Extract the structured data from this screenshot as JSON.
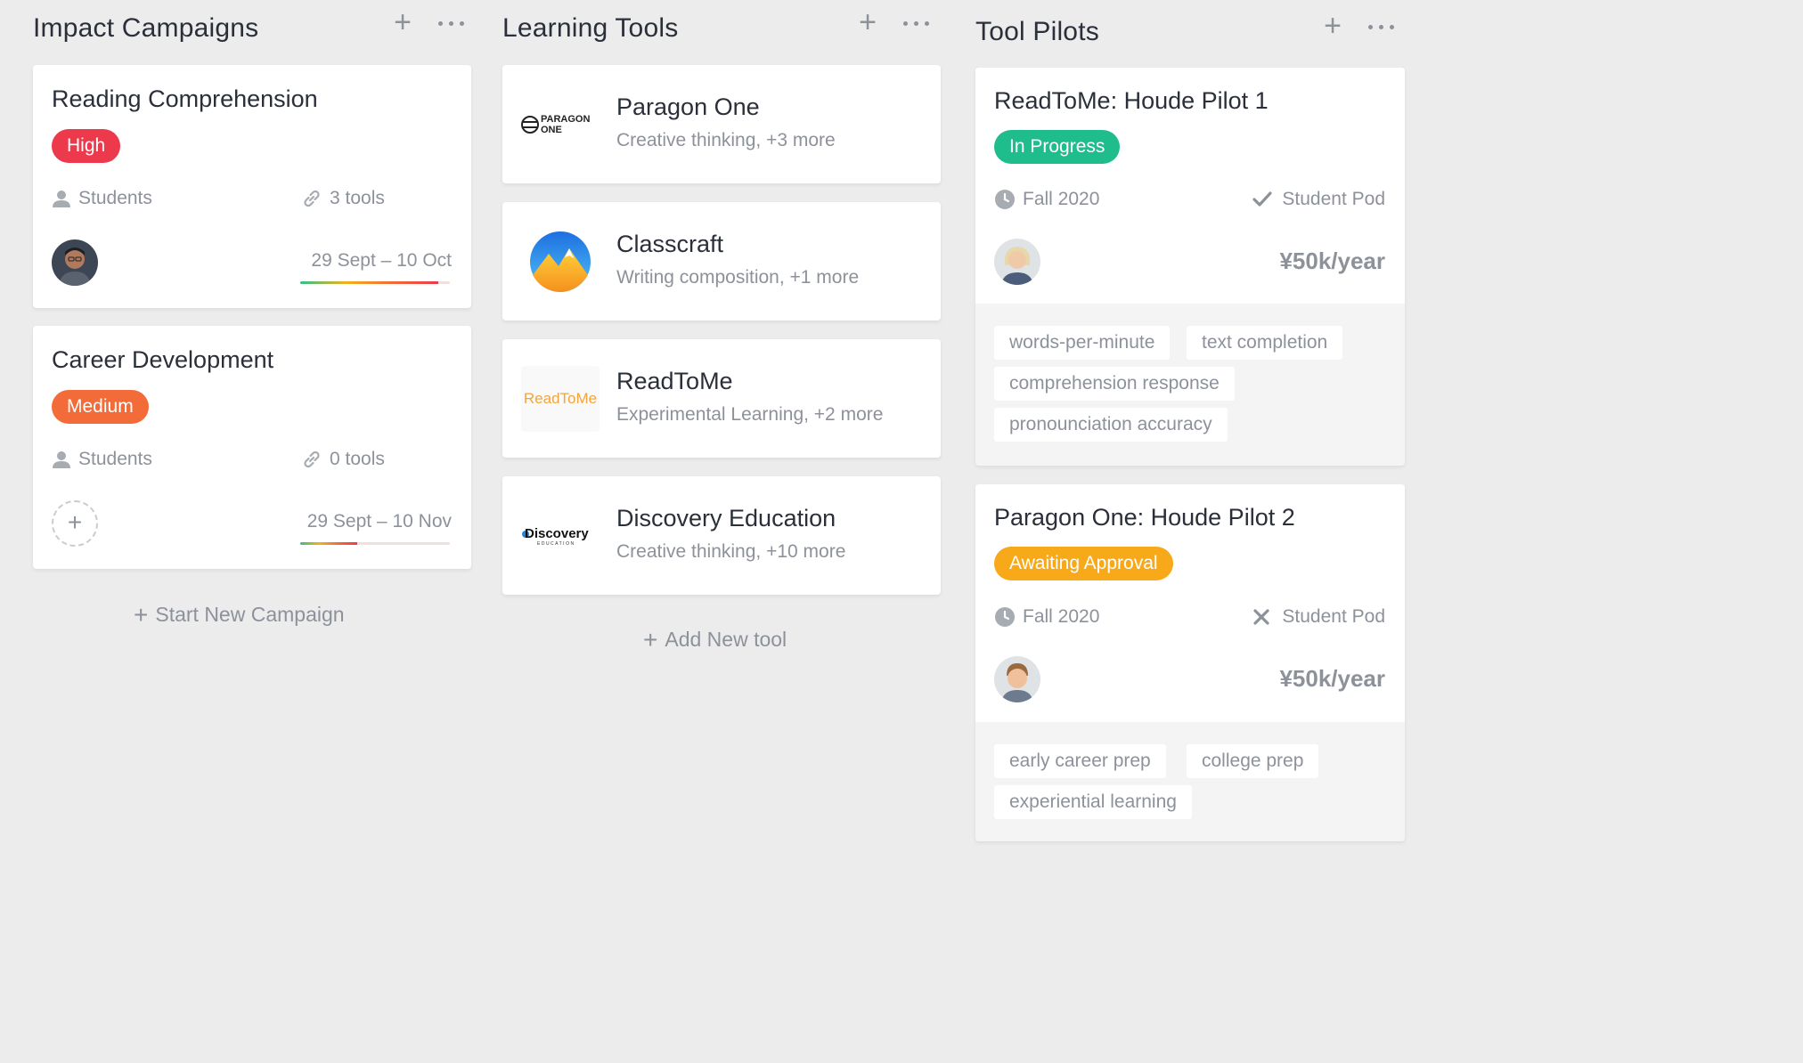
{
  "columns": {
    "campaigns": {
      "title": "Impact Campaigns",
      "add_label": "+",
      "cards": [
        {
          "title": "Reading Comprehension",
          "priority": "High",
          "priority_color": "#ec3a4c",
          "audience": "Students",
          "tools": "3 tools",
          "dates": "29 Sept – 10 Oct",
          "progress": 0.92,
          "has_avatar": true
        },
        {
          "title": "Career Development",
          "priority": "Medium",
          "priority_color": "#f36b38",
          "audience": "Students",
          "tools": "0 tools",
          "dates": "29 Sept – 10 Nov",
          "progress": 0.38,
          "has_avatar": false,
          "add_avatar": "+"
        }
      ],
      "footer": {
        "plus": "+",
        "label": "Start New Campaign"
      }
    },
    "tools": {
      "title": "Learning Tools",
      "add_label": "+",
      "cards": [
        {
          "name": "Paragon One",
          "subtitle": "Creative thinking, +3 more",
          "logo_text": "PARAGON ONE"
        },
        {
          "name": "Classcraft",
          "subtitle": "Writing composition, +1 more"
        },
        {
          "name": "ReadToMe",
          "subtitle": "Experimental Learning, +2 more",
          "logo_text": "ReadToMe"
        },
        {
          "name": "Discovery Education",
          "subtitle": "Creative thinking, +10 more",
          "logo_text": "Discovery",
          "logo_subtext": "EDUCATION"
        }
      ],
      "footer": {
        "plus": "+",
        "label": "Add New tool"
      }
    },
    "pilots": {
      "title": "Tool Pilots",
      "add_label": "+",
      "cards": [
        {
          "title": "ReadToMe: Houde Pilot 1",
          "status": "In Progress",
          "status_color": "#1fbc8c",
          "season": "Fall 2020",
          "pod": "Student Pod",
          "pod_icon": "check-icon",
          "price": "¥50k/year",
          "tags": [
            "words-per-minute",
            "text completion",
            "comprehension response",
            "pronounciation accuracy"
          ]
        },
        {
          "title": "Paragon One: Houde Pilot 2",
          "status": "Awaiting Approval",
          "status_color": "#f8a91a",
          "season": "Fall 2020",
          "pod": "Student Pod",
          "pod_icon": "x-icon",
          "price": "¥50k/year",
          "tags": [
            "early career prep",
            "college prep",
            "experiential learning"
          ]
        }
      ]
    }
  }
}
